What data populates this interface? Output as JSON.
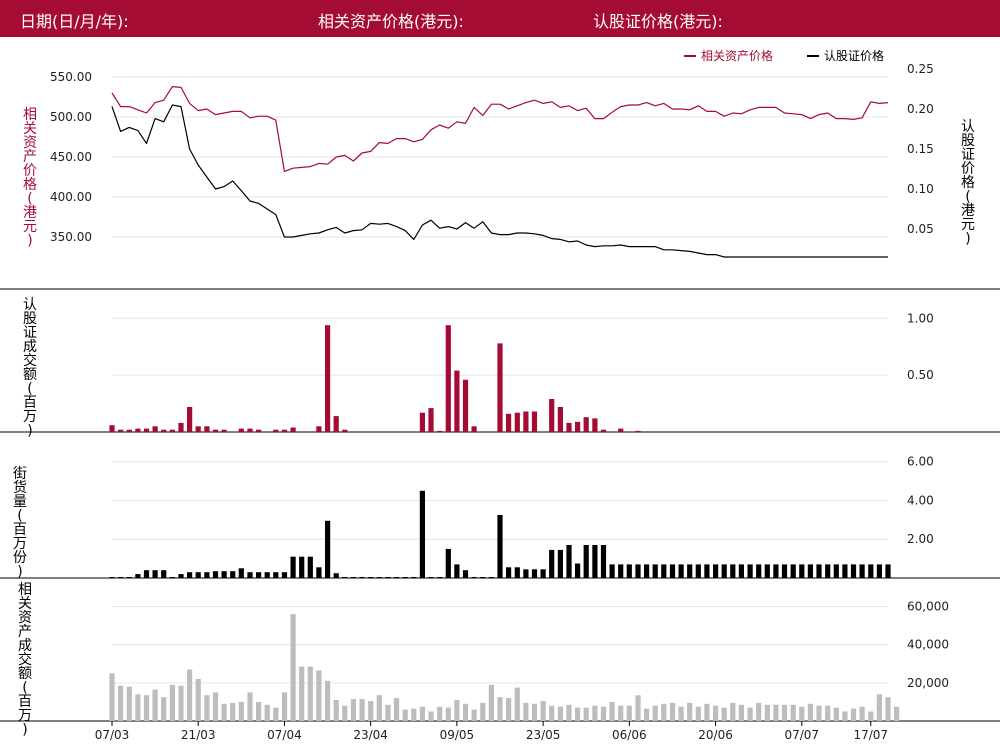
{
  "header": {
    "date_label": "日期(日/月/年):",
    "underlying_label": "相关资产价格(港元):",
    "warrant_label": "认股证价格(港元):"
  },
  "colors": {
    "underlying": "#a50c34",
    "warrant": "#000000",
    "volume_grey": "#bdbdbd",
    "header_bg": "#a50c34"
  },
  "chart_data": [
    {
      "type": "line",
      "legend_position": "top-right",
      "legend": [
        "相关资产价格",
        "认股证价格"
      ],
      "y_left_label": [
        "相",
        "关",
        "资",
        "产",
        "价",
        "格",
        "(",
        "港",
        "元",
        ")"
      ],
      "y_right_label": [
        "认",
        "股",
        "证",
        "价",
        "格",
        "(",
        "港",
        "元",
        ")"
      ],
      "y_left_ticks": [
        "550.00",
        "500.00",
        "450.00",
        "400.00",
        "350.00"
      ],
      "y_left_range": [
        315,
        565
      ],
      "y_right_ticks": [
        "0.25",
        "0.20",
        "0.15",
        "0.10",
        "0.05"
      ],
      "y_right_range": [
        0.005,
        0.255
      ],
      "series": [
        {
          "name": "相关资产价格",
          "axis": "left",
          "values": [
            530,
            513,
            513,
            509,
            505,
            518,
            521,
            538,
            537,
            517,
            508,
            510,
            503,
            505,
            507,
            507,
            499,
            501,
            501,
            496,
            432,
            436,
            437,
            438,
            442,
            441,
            450,
            452,
            445,
            455,
            457,
            468,
            467,
            473,
            473,
            469,
            472,
            484,
            490,
            486,
            494,
            492,
            512,
            502,
            516,
            516,
            510,
            514,
            518,
            521,
            517,
            519,
            512,
            514,
            508,
            511,
            498,
            498,
            506,
            513,
            515,
            515,
            518,
            514,
            517,
            510,
            510,
            509,
            514,
            507,
            507,
            501,
            505,
            504,
            509,
            512,
            512,
            512,
            505,
            504,
            503,
            498,
            503,
            505,
            498,
            498,
            497,
            499,
            519,
            517,
            518
          ]
        },
        {
          "name": "认股证价格",
          "axis": "right",
          "values": [
            0.203,
            0.172,
            0.177,
            0.173,
            0.157,
            0.188,
            0.184,
            0.205,
            0.203,
            0.15,
            0.13,
            0.115,
            0.1,
            0.103,
            0.11,
            0.098,
            0.085,
            0.082,
            0.075,
            0.068,
            0.04,
            0.04,
            0.042,
            0.044,
            0.045,
            0.049,
            0.052,
            0.045,
            0.048,
            0.049,
            0.057,
            0.056,
            0.057,
            0.053,
            0.048,
            0.037,
            0.055,
            0.061,
            0.051,
            0.053,
            0.05,
            0.058,
            0.051,
            0.059,
            0.045,
            0.043,
            0.043,
            0.045,
            0.045,
            0.044,
            0.042,
            0.038,
            0.037,
            0.034,
            0.035,
            0.03,
            0.028,
            0.029,
            0.029,
            0.03,
            0.028,
            0.028,
            0.028,
            0.028,
            0.024,
            0.024,
            0.023,
            0.022,
            0.02,
            0.018,
            0.018,
            0.015,
            0.015,
            0.015,
            0.015,
            0.015,
            0.015,
            0.015,
            0.015,
            0.015,
            0.015,
            0.015,
            0.015,
            0.015,
            0.015,
            0.015,
            0.015,
            0.015,
            0.015,
            0.015,
            0.015
          ]
        }
      ]
    },
    {
      "type": "bar",
      "y_label": [
        "认",
        "股",
        "证",
        "成",
        "交",
        "额",
        "(",
        "百",
        "万",
        ")"
      ],
      "y_ticks": [
        "1.00",
        "0.50"
      ],
      "y_range": [
        0,
        1.1
      ],
      "values": [
        0.06,
        0.02,
        0.02,
        0.03,
        0.03,
        0.05,
        0.02,
        0.02,
        0.08,
        0.22,
        0.05,
        0.05,
        0.02,
        0.02,
        0,
        0.03,
        0.03,
        0.02,
        0,
        0.02,
        0.02,
        0.04,
        0,
        0,
        0.05,
        0.94,
        0.14,
        0.02,
        0,
        0,
        0,
        0,
        0,
        0,
        0,
        0,
        0.17,
        0.21,
        0.01,
        0.94,
        0.54,
        0.46,
        0.05,
        0,
        0,
        0.78,
        0.16,
        0.17,
        0.18,
        0.18,
        0,
        0.29,
        0.22,
        0.08,
        0.09,
        0.13,
        0.12,
        0.02,
        0,
        0.03,
        0,
        0.01,
        0,
        0,
        0,
        0,
        0,
        0,
        0,
        0,
        0,
        0,
        0,
        0,
        0,
        0,
        0,
        0,
        0,
        0,
        0,
        0,
        0,
        0,
        0,
        0,
        0,
        0,
        0,
        0,
        0
      ]
    },
    {
      "type": "bar",
      "y_label": [
        "街",
        "货",
        "量",
        "(",
        "百",
        "万",
        "份",
        ")"
      ],
      "y_ticks": [
        "6.00",
        "4.00",
        "2.00"
      ],
      "y_range": [
        0,
        6.5
      ],
      "values": [
        0.05,
        0.05,
        0.05,
        0.2,
        0.4,
        0.4,
        0.4,
        0.05,
        0.2,
        0.3,
        0.3,
        0.3,
        0.35,
        0.35,
        0.35,
        0.5,
        0.3,
        0.3,
        0.3,
        0.3,
        0.3,
        1.1,
        1.1,
        1.1,
        0.55,
        2.95,
        0.25,
        0.05,
        0.05,
        0.05,
        0.05,
        0.05,
        0.05,
        0.05,
        0.05,
        0.05,
        4.5,
        0.05,
        0.05,
        1.5,
        0.7,
        0.4,
        0.05,
        0.05,
        0.05,
        3.25,
        0.55,
        0.55,
        0.45,
        0.45,
        0.45,
        1.45,
        1.45,
        1.7,
        0.75,
        1.7,
        1.7,
        1.7,
        0.7,
        0.7,
        0.7,
        0.7,
        0.7,
        0.7,
        0.7,
        0.7,
        0.7,
        0.7,
        0.7,
        0.7,
        0.7,
        0.7,
        0.7,
        0.7,
        0.7,
        0.7,
        0.7,
        0.7,
        0.7,
        0.7,
        0.7,
        0.7,
        0.7,
        0.7,
        0.7,
        0.7,
        0.7,
        0.7,
        0.7,
        0.7,
        0.7
      ]
    },
    {
      "type": "bar",
      "y_label": [
        "相",
        "关",
        "资",
        "产",
        "成",
        "交",
        "额",
        "(",
        "百",
        "万",
        ")"
      ],
      "y_ticks": [
        "60,000",
        "40,000",
        "20,000"
      ],
      "y_range": [
        0,
        65000
      ],
      "values": [
        25000,
        18500,
        18000,
        14000,
        13500,
        16500,
        12500,
        19000,
        18500,
        27000,
        22000,
        13500,
        15000,
        9000,
        9500,
        10000,
        15000,
        10000,
        8500,
        7000,
        15000,
        56000,
        28500,
        28500,
        26500,
        21000,
        11000,
        8000,
        11500,
        11500,
        10500,
        13500,
        8500,
        12000,
        6000,
        6500,
        7500,
        5000,
        7500,
        7000,
        11000,
        9000,
        6000,
        9500,
        19000,
        12500,
        12000,
        17500,
        9500,
        9000,
        10500,
        8000,
        7500,
        8500,
        7000,
        7000,
        8000,
        7500,
        10000,
        8000,
        8000,
        13500,
        6500,
        8000,
        9000,
        9500,
        7500,
        9500,
        7500,
        9000,
        8000,
        7000,
        9500,
        8500,
        7000,
        9500,
        8500,
        8500,
        8500,
        8500,
        7500,
        9000,
        8000,
        8000,
        7000,
        5000,
        6500,
        7500,
        5000,
        14000,
        12500,
        7500
      ]
    }
  ],
  "x_axis_ticks": [
    {
      "label": "07/03",
      "index": 0
    },
    {
      "label": "21/03",
      "index": 10
    },
    {
      "label": "07/04",
      "index": 20
    },
    {
      "label": "23/04",
      "index": 30
    },
    {
      "label": "09/05",
      "index": 40
    },
    {
      "label": "23/05",
      "index": 50
    },
    {
      "label": "06/06",
      "index": 60
    },
    {
      "label": "20/06",
      "index": 70
    },
    {
      "label": "07/07",
      "index": 80
    },
    {
      "label": "17/07",
      "index": 88
    }
  ]
}
